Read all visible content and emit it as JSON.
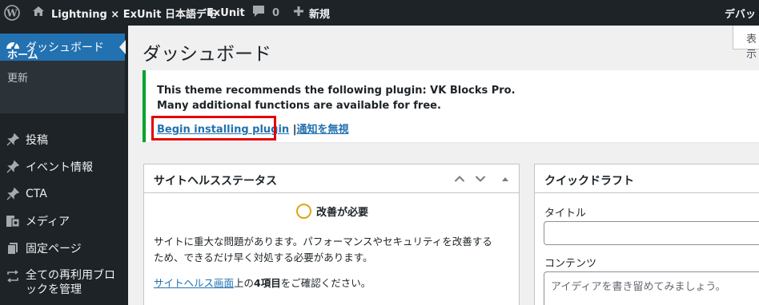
{
  "admin_bar": {
    "site_name": "Lightning × ExUnit 日本語デモ",
    "exunit": "ExUnit",
    "comments_count": "0",
    "new_label": "新規",
    "account_label": "デバッ"
  },
  "sidebar": {
    "dashboard": "ダッシュボード",
    "submenu": {
      "home": "ホーム",
      "updates": "更新"
    },
    "items": [
      {
        "label": "投稿",
        "icon": "pin-icon"
      },
      {
        "label": "イベント情報",
        "icon": "pin-icon"
      },
      {
        "label": "CTA",
        "icon": "pin-icon"
      },
      {
        "label": "メディア",
        "icon": "media-icon"
      },
      {
        "label": "固定ページ",
        "icon": "page-icon"
      },
      {
        "label": "全ての再利用ブロックを管理",
        "icon": "reusable-icon"
      }
    ]
  },
  "screen_options": "表示",
  "page_title": "ダッシュボード",
  "notice": {
    "line1": "This theme recommends the following plugin: VK Blocks Pro.",
    "line2": "Many additional functions are available for free.",
    "install_link": "Begin installing plugin",
    "separator": "|",
    "dismiss_link": "通知を無視"
  },
  "site_health": {
    "title": "サイトヘルスステータス",
    "status": "改善が必要",
    "desc_line1": "サイトに重大な問題があります。パフォーマンスやセキュリティを改善する",
    "desc_line2": "ため、できるだけ早く対処する必要があります。",
    "link_text": "サイトヘルス画面",
    "link_after_1": "上の",
    "link_count": "4項目",
    "link_after_2": "をご確認ください。"
  },
  "quick_draft": {
    "title": "クイックドラフト",
    "title_label": "タイトル",
    "content_label": "コンテンツ",
    "content_placeholder": "アイディアを書き留めてみましょう。"
  },
  "colors": {
    "admin_bar_bg": "#1d2327",
    "accent": "#2271b1",
    "notice_border": "#00a32a",
    "highlight": "#e30000",
    "status_ring": "#dba617"
  }
}
